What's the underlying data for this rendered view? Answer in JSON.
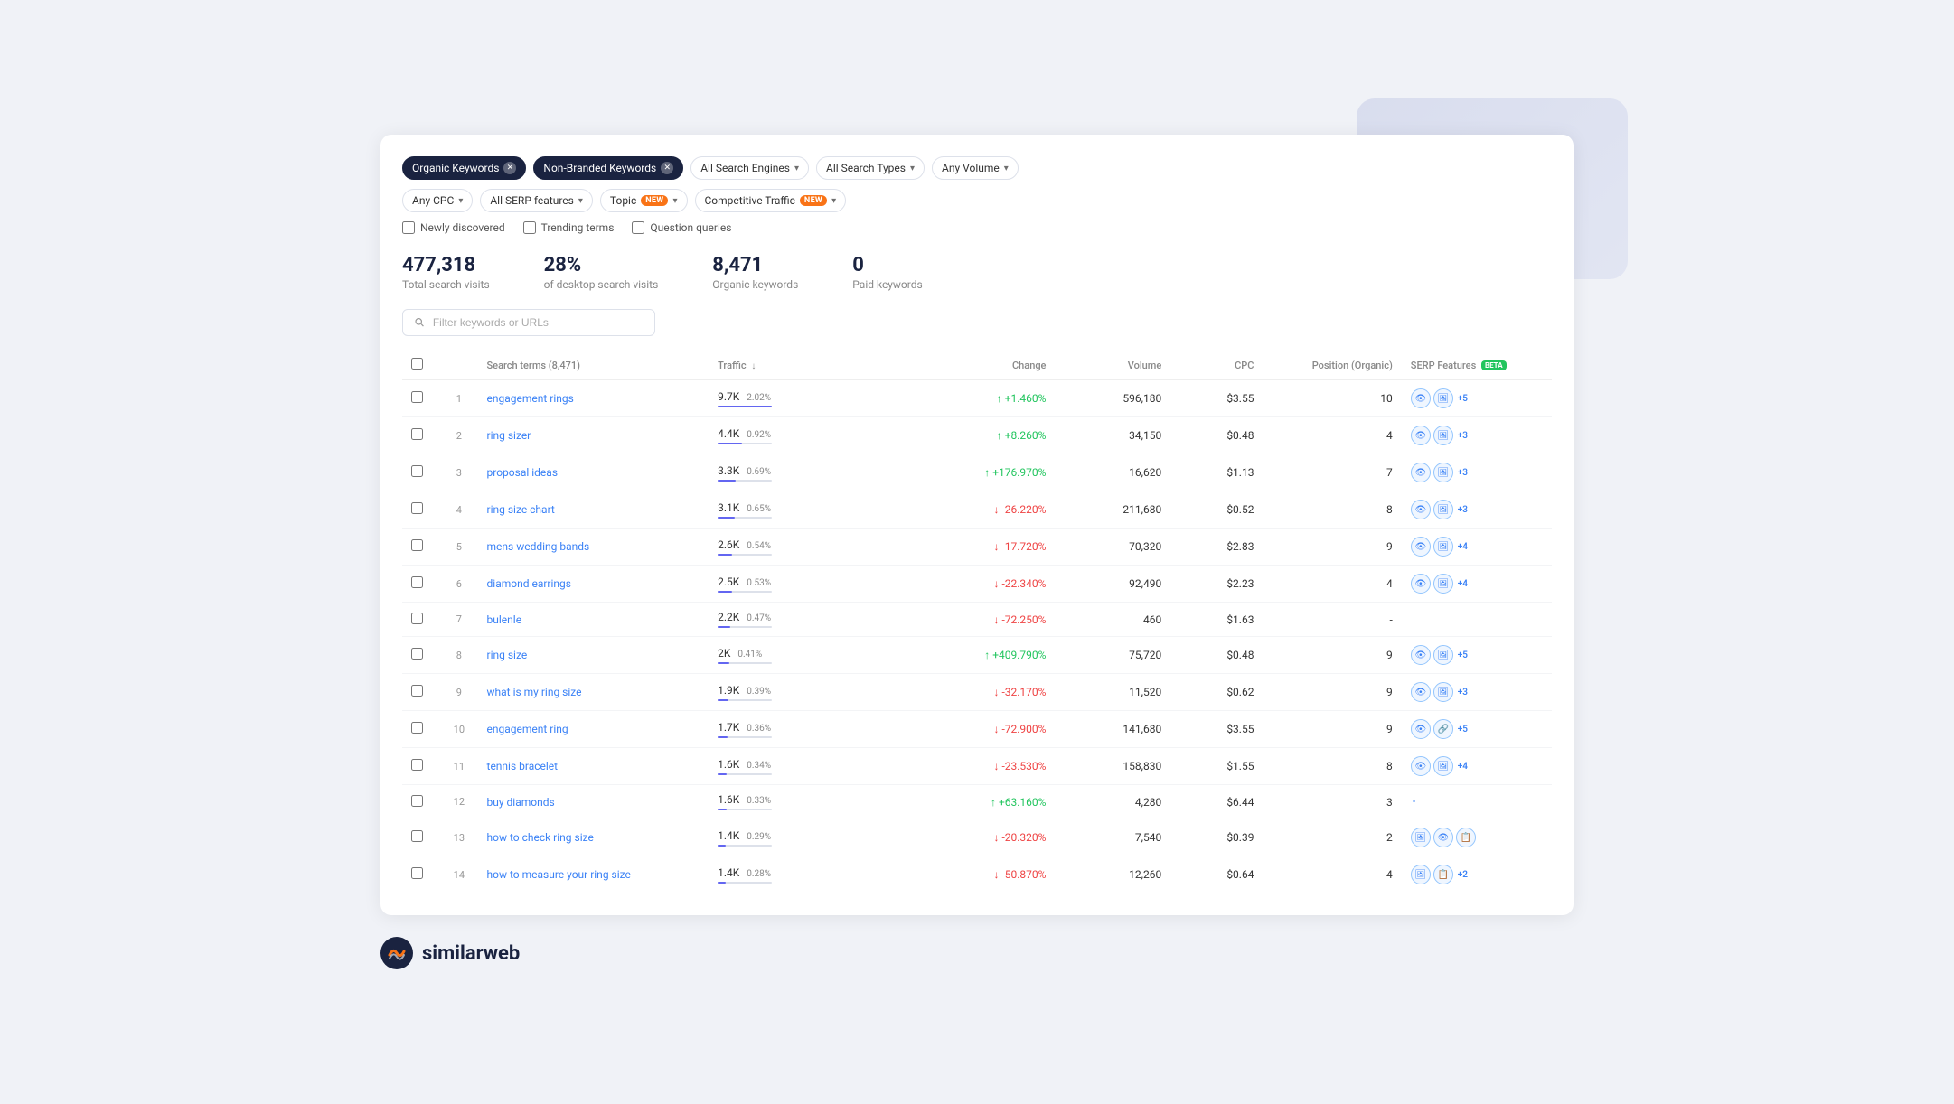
{
  "filters": {
    "row1": [
      {
        "id": "organic-keywords",
        "label": "Organic Keywords",
        "active": true,
        "hasClose": true
      },
      {
        "id": "non-branded",
        "label": "Non-Branded Keywords",
        "active": true,
        "hasClose": true
      },
      {
        "id": "all-search-engines",
        "label": "All Search Engines",
        "active": false,
        "hasChevron": true
      },
      {
        "id": "all-search-types",
        "label": "All Search Types",
        "active": false,
        "hasChevron": true
      },
      {
        "id": "any-volume",
        "label": "Any Volume",
        "active": false,
        "hasChevron": true
      }
    ],
    "row2": [
      {
        "id": "any-cpc",
        "label": "Any CPC",
        "active": false,
        "hasChevron": true
      },
      {
        "id": "all-serp",
        "label": "All SERP features",
        "active": false,
        "hasChevron": true
      },
      {
        "id": "topic",
        "label": "Topic",
        "active": false,
        "hasNew": true,
        "hasChevron": true
      },
      {
        "id": "competitive-traffic",
        "label": "Competitive Traffic",
        "active": false,
        "hasNew": true,
        "hasChevron": true
      }
    ],
    "checkboxes": [
      {
        "id": "newly-discovered",
        "label": "Newly discovered"
      },
      {
        "id": "trending-terms",
        "label": "Trending terms"
      },
      {
        "id": "question-queries",
        "label": "Question queries"
      }
    ]
  },
  "stats": {
    "total_visits": {
      "value": "477,318",
      "label": "Total search visits"
    },
    "desktop_pct": {
      "value": "28%",
      "label": "of desktop search visits"
    },
    "organic_kw": {
      "value": "8,471",
      "label": "Organic keywords"
    },
    "paid_kw": {
      "value": "0",
      "label": "Paid keywords"
    }
  },
  "table": {
    "search_placeholder": "Filter keywords or URLs",
    "header": {
      "search_terms": "Search terms (8,471)",
      "traffic": "Traffic",
      "change": "Change",
      "volume": "Volume",
      "cpc": "CPC",
      "position": "Position (Organic)",
      "serp": "SERP Features"
    },
    "rows": [
      {
        "num": 1,
        "keyword": "engagement rings",
        "traffic": "9.7K",
        "traffic_pct": "2.02%",
        "traffic_bar": 100,
        "change": "+1.460%",
        "change_up": true,
        "volume": "596,180",
        "cpc": "$3.55",
        "position": "10",
        "serp_icons": [
          "eye",
          "image"
        ],
        "serp_more": "+5"
      },
      {
        "num": 2,
        "keyword": "ring sizer",
        "traffic": "4.4K",
        "traffic_pct": "0.92%",
        "traffic_bar": 45,
        "change": "+8.260%",
        "change_up": true,
        "volume": "34,150",
        "cpc": "$0.48",
        "position": "4",
        "serp_icons": [
          "eye",
          "image"
        ],
        "serp_more": "+3"
      },
      {
        "num": 3,
        "keyword": "proposal ideas",
        "traffic": "3.3K",
        "traffic_pct": "0.69%",
        "traffic_bar": 34,
        "change": "+176.970%",
        "change_up": true,
        "volume": "16,620",
        "cpc": "$1.13",
        "position": "7",
        "serp_icons": [
          "eye",
          "image"
        ],
        "serp_more": "+3"
      },
      {
        "num": 4,
        "keyword": "ring size chart",
        "traffic": "3.1K",
        "traffic_pct": "0.65%",
        "traffic_bar": 32,
        "change": "-26.220%",
        "change_up": false,
        "volume": "211,680",
        "cpc": "$0.52",
        "position": "8",
        "serp_icons": [
          "eye",
          "image"
        ],
        "serp_more": "+3"
      },
      {
        "num": 5,
        "keyword": "mens wedding bands",
        "traffic": "2.6K",
        "traffic_pct": "0.54%",
        "traffic_bar": 27,
        "change": "-17.720%",
        "change_up": false,
        "volume": "70,320",
        "cpc": "$2.83",
        "position": "9",
        "serp_icons": [
          "eye",
          "image"
        ],
        "serp_more": "+4"
      },
      {
        "num": 6,
        "keyword": "diamond earrings",
        "traffic": "2.5K",
        "traffic_pct": "0.53%",
        "traffic_bar": 26,
        "change": "-22.340%",
        "change_up": false,
        "volume": "92,490",
        "cpc": "$2.23",
        "position": "4",
        "serp_icons": [
          "eye",
          "image"
        ],
        "serp_more": "+4"
      },
      {
        "num": 7,
        "keyword": "bulenle",
        "traffic": "2.2K",
        "traffic_pct": "0.47%",
        "traffic_bar": 23,
        "change": "-72.250%",
        "change_up": false,
        "volume": "460",
        "cpc": "$1.63",
        "position": "-",
        "serp_icons": [],
        "serp_more": ""
      },
      {
        "num": 8,
        "keyword": "ring size",
        "traffic": "2K",
        "traffic_pct": "0.41%",
        "traffic_bar": 21,
        "change": "+409.790%",
        "change_up": true,
        "volume": "75,720",
        "cpc": "$0.48",
        "position": "9",
        "serp_icons": [
          "eye",
          "image"
        ],
        "serp_more": "+5"
      },
      {
        "num": 9,
        "keyword": "what is my ring size",
        "traffic": "1.9K",
        "traffic_pct": "0.39%",
        "traffic_bar": 20,
        "change": "-32.170%",
        "change_up": false,
        "volume": "11,520",
        "cpc": "$0.62",
        "position": "9",
        "serp_icons": [
          "eye",
          "image"
        ],
        "serp_more": "+3"
      },
      {
        "num": 10,
        "keyword": "engagement ring",
        "traffic": "1.7K",
        "traffic_pct": "0.36%",
        "traffic_bar": 18,
        "change": "-72.900%",
        "change_up": false,
        "volume": "141,680",
        "cpc": "$3.55",
        "position": "9",
        "serp_icons": [
          "eye",
          "link"
        ],
        "serp_more": "+5"
      },
      {
        "num": 11,
        "keyword": "tennis bracelet",
        "traffic": "1.6K",
        "traffic_pct": "0.34%",
        "traffic_bar": 17,
        "change": "-23.530%",
        "change_up": false,
        "volume": "158,830",
        "cpc": "$1.55",
        "position": "8",
        "serp_icons": [
          "eye",
          "image"
        ],
        "serp_more": "+4"
      },
      {
        "num": 12,
        "keyword": "buy diamonds",
        "traffic": "1.6K",
        "traffic_pct": "0.33%",
        "traffic_bar": 17,
        "change": "+63.160%",
        "change_up": true,
        "volume": "4,280",
        "cpc": "$6.44",
        "position": "3",
        "serp_icons": [],
        "serp_more": "-"
      },
      {
        "num": 13,
        "keyword": "how to check ring size",
        "traffic": "1.4K",
        "traffic_pct": "0.29%",
        "traffic_bar": 15,
        "change": "-20.320%",
        "change_up": false,
        "volume": "7,540",
        "cpc": "$0.39",
        "position": "2",
        "serp_icons": [
          "image",
          "eye",
          "copy"
        ],
        "serp_more": ""
      },
      {
        "num": 14,
        "keyword": "how to measure your ring size",
        "traffic": "1.4K",
        "traffic_pct": "0.28%",
        "traffic_bar": 15,
        "change": "-50.870%",
        "change_up": false,
        "volume": "12,260",
        "cpc": "$0.64",
        "position": "4",
        "serp_icons": [
          "image",
          "copy"
        ],
        "serp_more": "+2"
      }
    ]
  },
  "logo": {
    "text": "similarweb"
  }
}
